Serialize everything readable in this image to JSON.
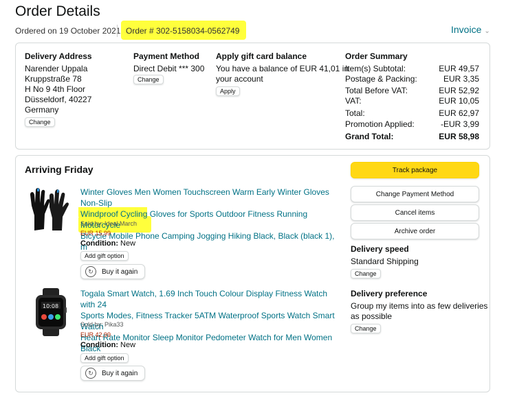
{
  "header": {
    "title": "Order Details",
    "ordered_on": "Ordered on 19 October 2021",
    "order_number": "Order # 302-5158034-0562749",
    "invoice_label": "Invoice"
  },
  "delivery_address": {
    "heading": "Delivery Address",
    "lines": [
      "Narender Uppala",
      "Kruppstraße 78",
      "H No 9 4th Floor",
      "Düsseldorf, 40227",
      "Germany"
    ],
    "change_label": "Change"
  },
  "payment_method": {
    "heading": "Payment Method",
    "value": "Direct Debit *** 300",
    "change_label": "Change"
  },
  "gift_card": {
    "heading": "Apply gift card balance",
    "line1": "You have a balance of EUR 41,01 in",
    "line2": "your account",
    "apply_label": "Apply"
  },
  "order_summary": {
    "heading": "Order Summary",
    "rows": [
      {
        "label": "Item(s) Subtotal:",
        "value": "EUR 49,57"
      },
      {
        "label": "Postage & Packing:",
        "value": "EUR 3,35"
      },
      {
        "label": "Total Before VAT:",
        "value": "EUR 52,92"
      },
      {
        "label": "VAT:",
        "value": "EUR 10,05"
      },
      {
        "label": "Total:",
        "value": "EUR 62,97"
      },
      {
        "label": "Promotion Applied:",
        "value": "-EUR 3,99"
      },
      {
        "label": "Grand Total:",
        "value": "EUR 58,98"
      }
    ]
  },
  "shipment": {
    "heading": "Arriving Friday",
    "items": [
      {
        "title_l1": "Winter Gloves Men Women Touchscreen Warm Early Winter Gloves Non-Slip",
        "title_l2": "Windproof Cycling Gloves for Sports Outdoor Fitness Running Motorcycle",
        "title_l3": "Bicycle Mobile Phone Camping Jogging Hiking Black, Black (black 1), m",
        "sold_by": "Sold by: Ideal March",
        "price": "EUR 15,99",
        "condition_label": "Condition:",
        "condition_value": "New",
        "gift_label": "Add gift option",
        "buy_label": "Buy it again"
      },
      {
        "title_l1": "Togala Smart Watch, 1.69 Inch Touch Colour Display Fitness Watch with 24",
        "title_l2": "Sports Modes, Fitness Tracker 5ATM Waterproof Sports Watch Smart Watch",
        "title_l3": "Heart Rate Monitor Sleep Monitor Pedometer Watch for Men Women Black",
        "sold_by": "Sold by: Pika33",
        "price": "EUR 42,99",
        "condition_label": "Condition:",
        "condition_value": "New",
        "gift_label": "Add gift option",
        "buy_label": "Buy it again"
      }
    ]
  },
  "actions": {
    "track": "Track package",
    "change_payment": "Change Payment Method",
    "cancel": "Cancel items",
    "archive": "Archive order"
  },
  "delivery_speed": {
    "heading": "Delivery speed",
    "value": "Standard Shipping",
    "change_label": "Change"
  },
  "delivery_preference": {
    "heading": "Delivery preference",
    "line1": "Group my items into as few deliveries",
    "line2": "as possible",
    "change_label": "Change"
  },
  "colors": {
    "accent_link": "#007185",
    "track_button": "#ffd814",
    "price": "#b12704",
    "highlight": "#ffff3c"
  }
}
